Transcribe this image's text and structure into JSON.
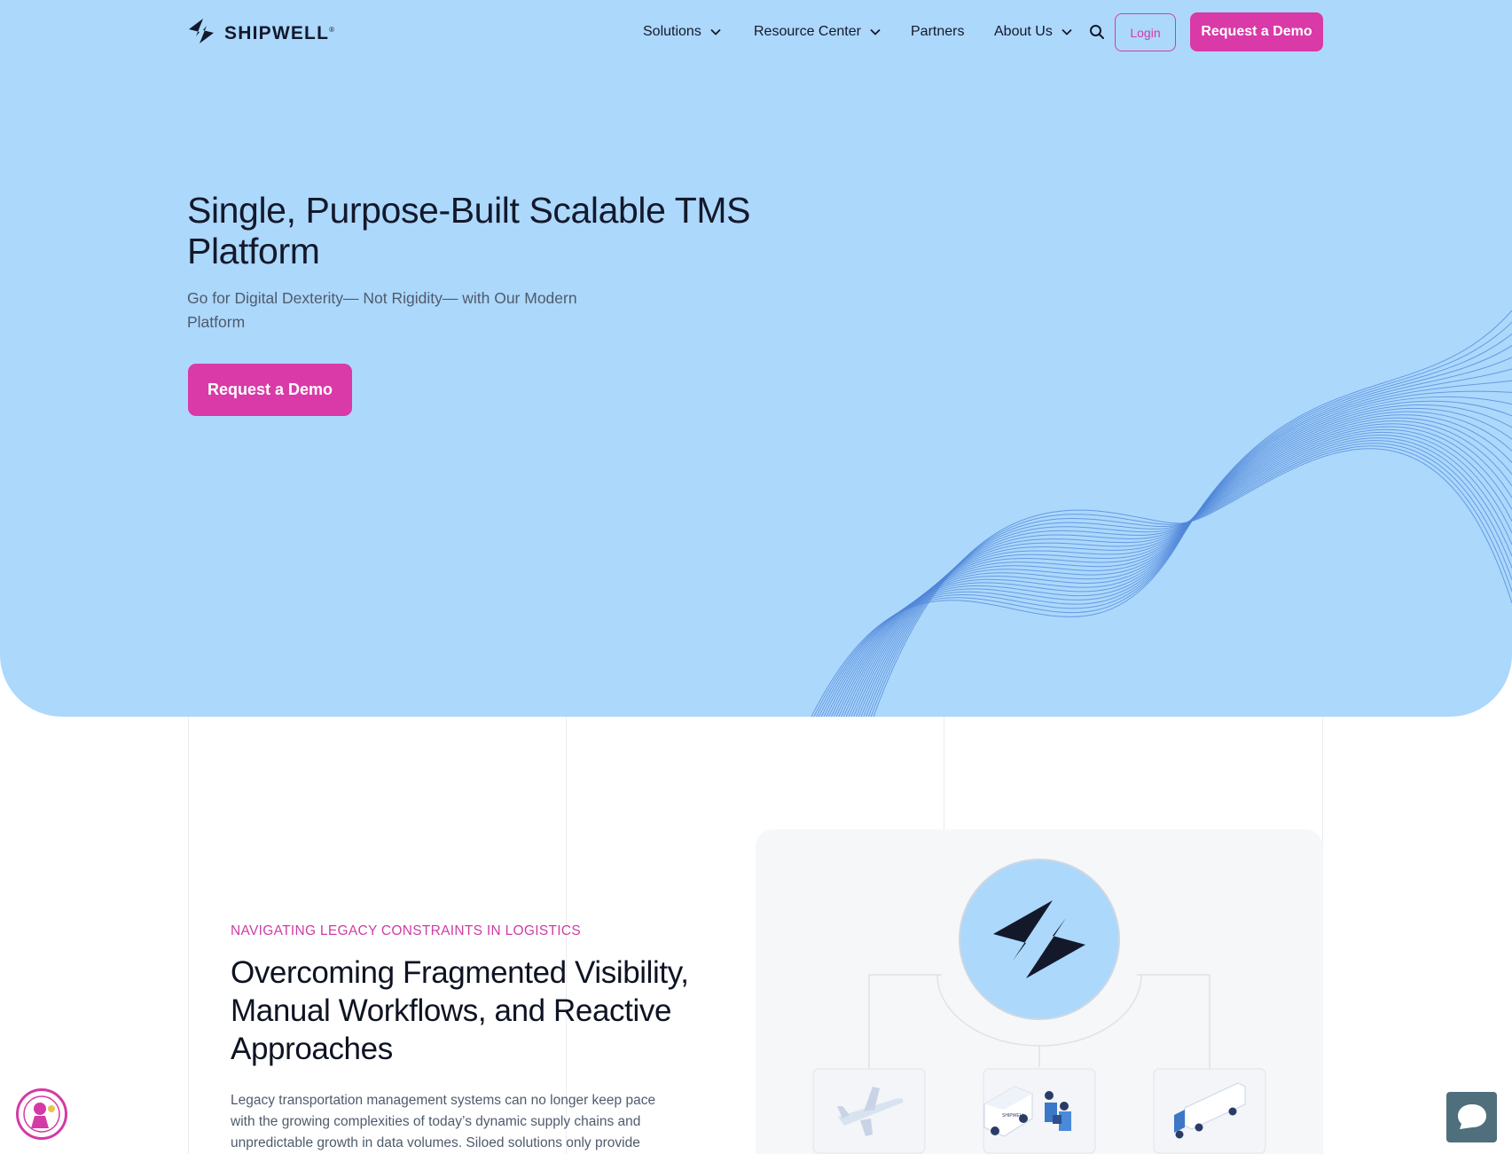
{
  "brand": {
    "name": "SHIPWELL",
    "reg": "®"
  },
  "nav": {
    "solutions": "Solutions",
    "resources": "Resource Center",
    "partners": "Partners",
    "about": "About Us",
    "login": "Login",
    "demo": "Request a Demo"
  },
  "hero": {
    "title": "Single, Purpose-Built Scalable TMS Platform",
    "subtitle": "Go for Digital Dexterity— Not Rigidity— with Our Modern Platform",
    "cta": "Request a Demo"
  },
  "section": {
    "eyebrow": "NAVIGATING LEGACY CONSTRAINTS IN LOGISTICS",
    "title": "Overcoming Fragmented Visibility, Manual Workflows, and Reactive Approaches",
    "body": "Legacy transportation management systems can no longer keep pace with the growing complexities of today’s dynamic supply chains and unpredictable growth in data volumes. Siloed solutions only provide"
  },
  "icons": {
    "logo": "shipwell-logo-icon",
    "chevron": "chevron-down-icon",
    "search": "search-icon",
    "plane": "airplane-icon",
    "van": "delivery-van-icon",
    "truck": "truck-icon",
    "badge": "award-badge-icon",
    "chat": "chat-icon"
  },
  "colors": {
    "hero_bg": "#acd8fc",
    "accent": "#d93aa7",
    "text_dark": "#13192b",
    "wave": "#4f86d8"
  }
}
